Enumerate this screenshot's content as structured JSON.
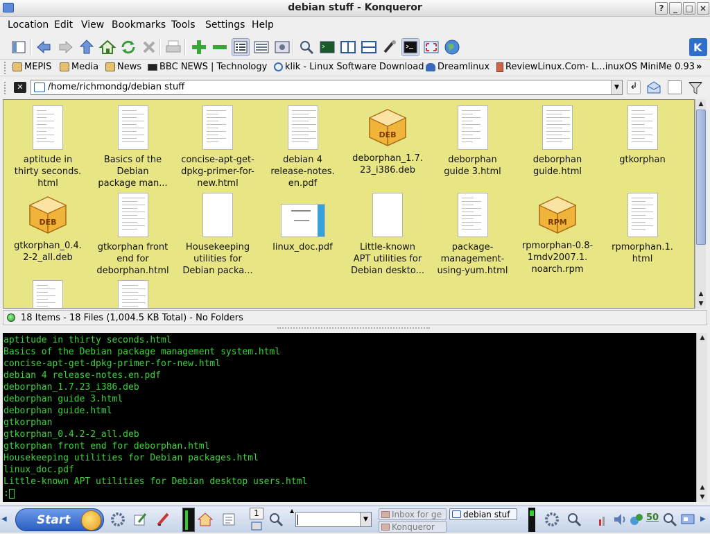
{
  "window": {
    "title": "debian stuff - Konqueror"
  },
  "window_buttons": [
    "?",
    "_",
    "□",
    "×"
  ],
  "menu": [
    "Location",
    "Edit",
    "View",
    "Bookmarks",
    "Tools",
    "Settings",
    "Help"
  ],
  "toolbar_icons": [
    "view-sidebar-icon",
    "back-icon",
    "forward-icon",
    "up-icon",
    "home-icon",
    "reload-icon",
    "stop-icon",
    "print-icon",
    "zoom-in-icon",
    "zoom-out-icon",
    "icon-view-icon",
    "list-view-icon",
    "image-preview-icon",
    "find-icon",
    "terminal-view-icon",
    "split-vertical-icon",
    "split-horizontal-icon",
    "security-icon",
    "shell-icon",
    "fullscreen-icon",
    "globe-icon"
  ],
  "bookmarks": [
    {
      "label": "MEPIS",
      "icon": "folder-icon"
    },
    {
      "label": "Media",
      "icon": "folder-icon"
    },
    {
      "label": "News",
      "icon": "folder-icon"
    },
    {
      "label": "BBC NEWS | Technology",
      "icon": "bbc-icon"
    },
    {
      "label": "klik - Linux Software Download",
      "icon": "klik-icon"
    },
    {
      "label": "Dreamlinux",
      "icon": "dreamlinux-icon"
    },
    {
      "label": "ReviewLinux.Com- L...inuxOS MiniMe 0.93",
      "icon": "reviewlinux-icon"
    }
  ],
  "location": {
    "path": "/home/richmondg/debian stuff"
  },
  "files": [
    {
      "l1": "aptitude in",
      "l2": "thirty seconds.",
      "l3": "html",
      "type": "doc"
    },
    {
      "l1": "Basics of the",
      "l2": "Debian",
      "l3": "package man...",
      "type": "doc"
    },
    {
      "l1": "concise-apt-get-",
      "l2": "dpkg-primer-for-",
      "l3": "new.html",
      "type": "doc"
    },
    {
      "l1": "debian 4",
      "l2": "release-notes.",
      "l3": "en.pdf",
      "type": "doc"
    },
    {
      "l1": "deborphan_1.7.",
      "l2": "23_i386.deb",
      "l3": "",
      "type": "deb"
    },
    {
      "l1": "deborphan",
      "l2": "guide 3.html",
      "l3": "",
      "type": "doc"
    },
    {
      "l1": "deborphan",
      "l2": "guide.html",
      "l3": "",
      "type": "doc"
    },
    {
      "l1": "gtkorphan",
      "l2": "",
      "l3": "",
      "type": "doc"
    },
    {
      "l1": "gtkorphan_0.4.",
      "l2": "2-2_all.deb",
      "l3": "",
      "type": "deb"
    },
    {
      "l1": "gtkorphan front",
      "l2": "end for",
      "l3": "deborphan.html",
      "type": "doc"
    },
    {
      "l1": "Housekeeping",
      "l2": "utilities for",
      "l3": "Debian packa...",
      "type": "blank"
    },
    {
      "l1": "linux_doc.pdf",
      "l2": "",
      "l3": "",
      "type": "pdf"
    },
    {
      "l1": "Little-known",
      "l2": "APT utilities for",
      "l3": "Debian deskto...",
      "type": "blank"
    },
    {
      "l1": "package-",
      "l2": "management-",
      "l3": "using-yum.html",
      "type": "doc"
    },
    {
      "l1": "rpmorphan-0.8-",
      "l2": "1mdv2007.1.",
      "l3": "noarch.rpm",
      "type": "rpm"
    },
    {
      "l1": "rpmorphan.1.",
      "l2": "html",
      "l3": "",
      "type": "doc"
    },
    {
      "l1": "",
      "l2": "",
      "l3": "",
      "type": "doc"
    },
    {
      "l1": "",
      "l2": "",
      "l3": "",
      "type": "doc"
    }
  ],
  "pkg_labels": {
    "deb": "DEB",
    "rpm": "RPM"
  },
  "status": {
    "text": "18 Items - 18 Files (1,004.5 KB Total) - No Folders"
  },
  "terminal": {
    "lines": [
      "aptitude in thirty seconds.html",
      "Basics of the Debian package management system.html",
      "concise-apt-get-dpkg-primer-for-new.html",
      "debian 4 release-notes.en.pdf",
      "deborphan_1.7.23_i386.deb",
      "deborphan guide 3.html",
      "deborphan guide.html",
      "gtkorphan",
      "gtkorphan_0.4.2-2_all.deb",
      "gtkorphan front end for deborphan.html",
      "Housekeeping utilities for Debian packages.html",
      "linux_doc.pdf",
      "Little-known APT utilities for Debian desktop users.html"
    ],
    "prompt": ":"
  },
  "taskbar": {
    "start_label": "Start",
    "desktop_number": "1",
    "tasks": [
      "Inbox for ge",
      "debian stuf",
      "Konqueror"
    ],
    "clock": "50"
  },
  "colors": {
    "icon_bg": "#e8e585",
    "terminal_fg": "#3bd43b",
    "accent": "#3a7bd5"
  }
}
